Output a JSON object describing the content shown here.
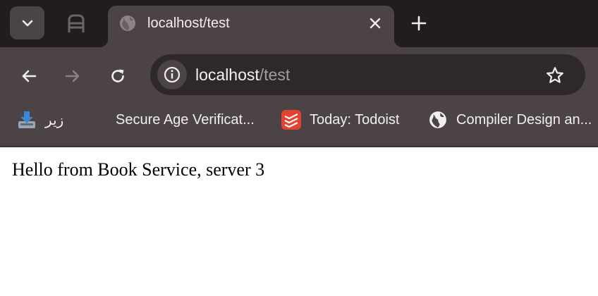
{
  "tab": {
    "title": "localhost/test"
  },
  "address_bar": {
    "host": "localhost",
    "path": "/test"
  },
  "bookmarks": [
    {
      "label": "زیر",
      "icon": "download-tray-icon"
    },
    {
      "label": "Secure Age Verificat...",
      "icon": "none"
    },
    {
      "label": "Today: Todoist",
      "icon": "todoist-icon"
    },
    {
      "label": "Compiler Design an...",
      "icon": "globe-icon"
    }
  ],
  "page": {
    "body_text": "Hello from Book Service, server 3"
  },
  "colors": {
    "tabstrip": "#211c1e",
    "toolbar": "#4b4346",
    "omnibox": "#2f282b",
    "todoist": "#e44332"
  }
}
